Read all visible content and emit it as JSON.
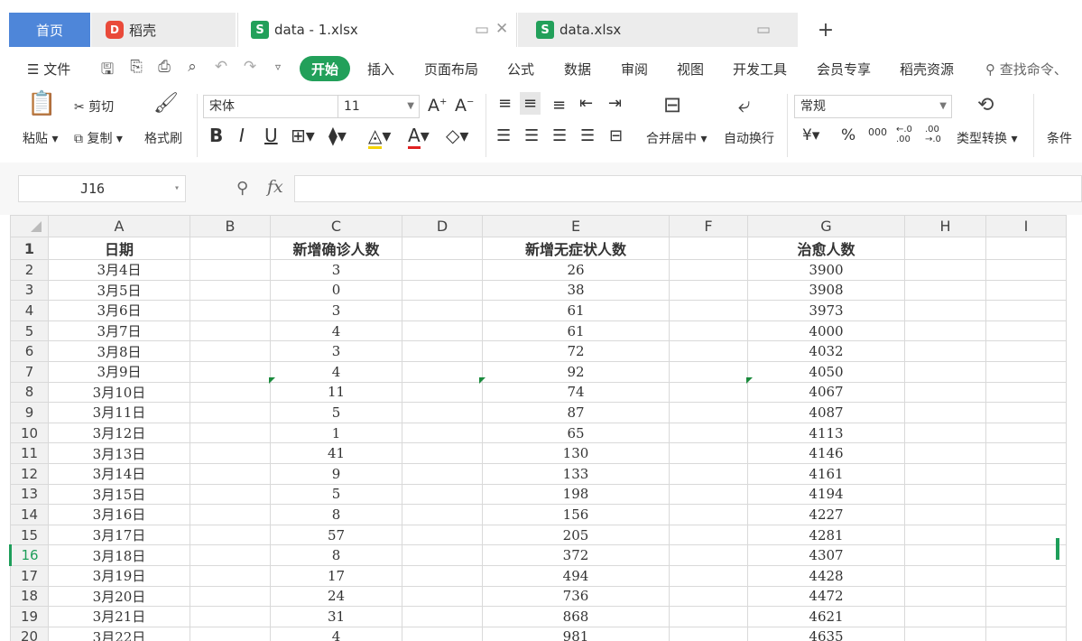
{
  "tabs": {
    "home": "首页",
    "daoke": "稻壳",
    "file1": "data - 1.xlsx",
    "file2": "data.xlsx",
    "new": "+"
  },
  "menu": {
    "file": "文件",
    "start": "开始",
    "items": [
      "插入",
      "页面布局",
      "公式",
      "数据",
      "审阅",
      "视图",
      "开发工具",
      "会员专享",
      "稻壳资源"
    ],
    "search": "查找命令、"
  },
  "ribbon": {
    "paste": "粘贴",
    "cut": "剪切",
    "copy": "复制",
    "format_painter": "格式刷",
    "font_name": "宋体",
    "font_size": "11",
    "bold": "B",
    "italic": "I",
    "underline": "U",
    "merge": "合并居中",
    "wrap": "自动换行",
    "number_format": "常规",
    "currency": "¥",
    "percent": "%",
    "thousands": "000",
    "type_convert": "类型转换",
    "conditional": "条件"
  },
  "formula_bar": {
    "cell_ref": "J16",
    "fx": "fx",
    "value": ""
  },
  "columns": [
    "A",
    "B",
    "C",
    "D",
    "E",
    "F",
    "G",
    "H",
    "I"
  ],
  "headers": [
    "日期",
    "",
    "新增确诊人数",
    "",
    "新增无症状人数",
    "",
    "治愈人数",
    "",
    ""
  ],
  "rows": [
    {
      "n": "2",
      "a": "3月4日",
      "c": "3",
      "e": "26",
      "g": "3900"
    },
    {
      "n": "3",
      "a": "3月5日",
      "c": "0",
      "e": "38",
      "g": "3908"
    },
    {
      "n": "4",
      "a": "3月6日",
      "c": "3",
      "e": "61",
      "g": "3973"
    },
    {
      "n": "5",
      "a": "3月7日",
      "c": "4",
      "e": "61",
      "g": "4000"
    },
    {
      "n": "6",
      "a": "3月8日",
      "c": "3",
      "e": "72",
      "g": "4032"
    },
    {
      "n": "7",
      "a": "3月9日",
      "c": "4",
      "e": "92",
      "g": "4050"
    },
    {
      "n": "8",
      "a": "3月10日",
      "c": "11",
      "e": "74",
      "g": "4067"
    },
    {
      "n": "9",
      "a": "3月11日",
      "c": "5",
      "e": "87",
      "g": "4087"
    },
    {
      "n": "10",
      "a": "3月12日",
      "c": "1",
      "e": "65",
      "g": "4113"
    },
    {
      "n": "11",
      "a": "3月13日",
      "c": "41",
      "e": "130",
      "g": "4146"
    },
    {
      "n": "12",
      "a": "3月14日",
      "c": "9",
      "e": "133",
      "g": "4161"
    },
    {
      "n": "13",
      "a": "3月15日",
      "c": "5",
      "e": "198",
      "g": "4194"
    },
    {
      "n": "14",
      "a": "3月16日",
      "c": "8",
      "e": "156",
      "g": "4227"
    },
    {
      "n": "15",
      "a": "3月17日",
      "c": "57",
      "e": "205",
      "g": "4281"
    },
    {
      "n": "16",
      "a": "3月18日",
      "c": "8",
      "e": "372",
      "g": "4307"
    },
    {
      "n": "17",
      "a": "3月19日",
      "c": "17",
      "e": "494",
      "g": "4428"
    },
    {
      "n": "18",
      "a": "3月20日",
      "c": "24",
      "e": "736",
      "g": "4472"
    },
    {
      "n": "19",
      "a": "3月21日",
      "c": "31",
      "e": "868",
      "g": "4621"
    },
    {
      "n": "20",
      "a": "3月22日",
      "c": "4",
      "e": "981",
      "g": "4635"
    }
  ],
  "selected_row": "16",
  "colors": {
    "accent": "#22a05a",
    "home_tab": "#4e86d9",
    "daoke": "#e94a3a"
  }
}
